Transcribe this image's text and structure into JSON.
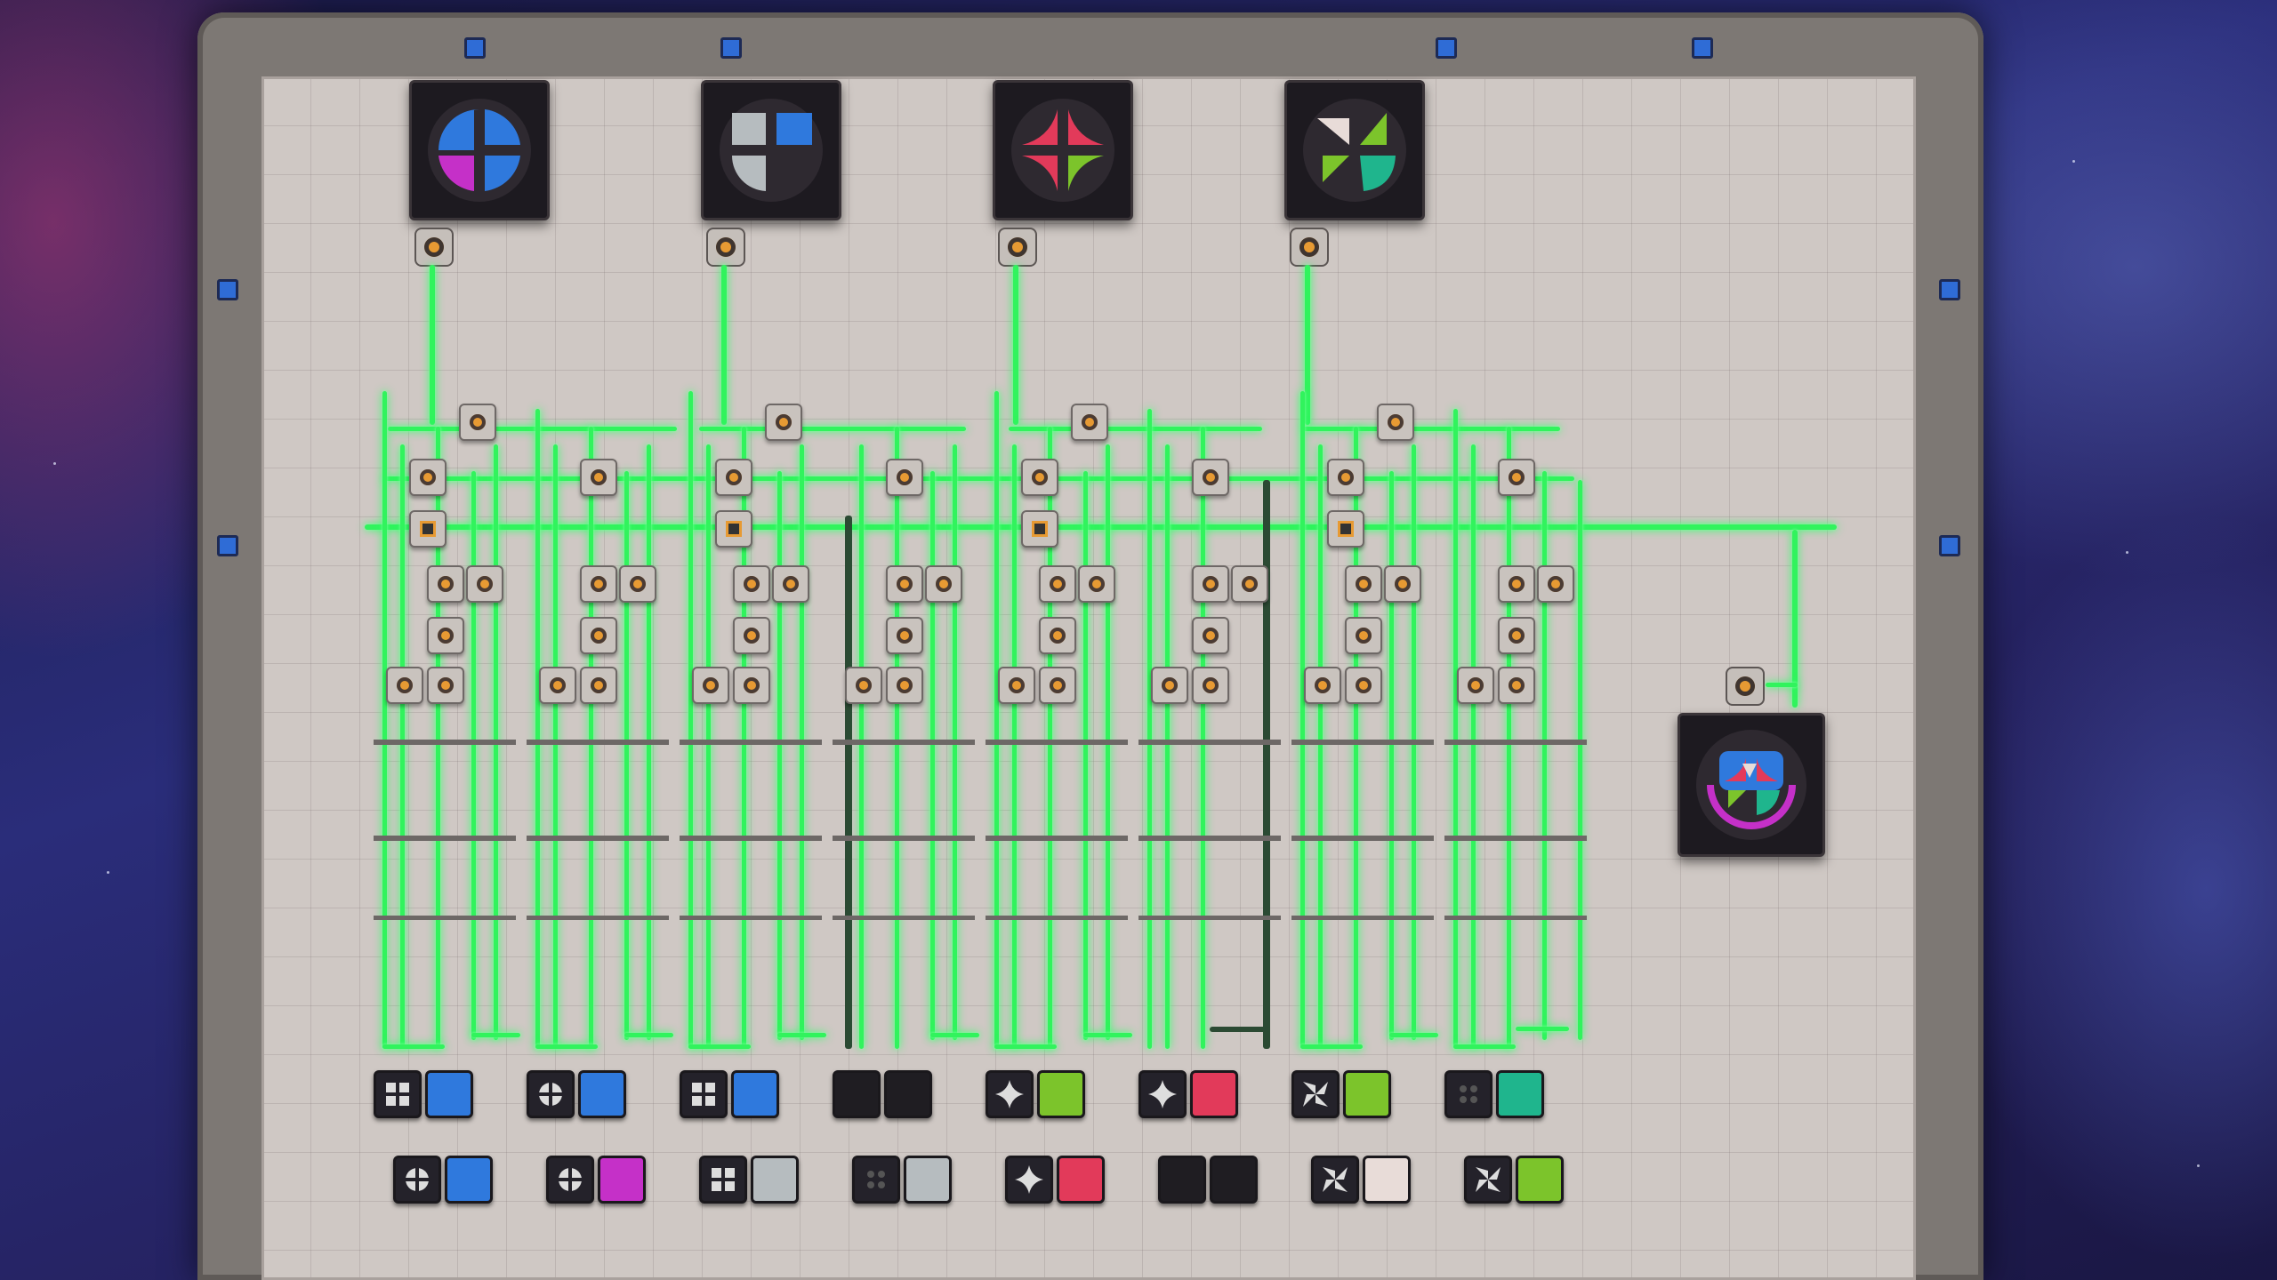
{
  "colors": {
    "belt": "#31f35d",
    "blue": "#2f79dd",
    "magenta": "#c530c8",
    "gray": "#b6bcbf",
    "green": "#7cc42b",
    "red": "#e23a5a",
    "teal": "#1fb58d",
    "pale": "#e8dcd8",
    "black": "#1f1d22"
  },
  "hubs": [
    {
      "name": "quad-blue-magenta-shape-icon"
    },
    {
      "name": "quad-gray-blue-shape-icon"
    },
    {
      "name": "star-red-green-shape-icon"
    },
    {
      "name": "windmill-green-teal-shape-icon"
    }
  ],
  "output_hub": {
    "name": "combined-multicolor-shape-icon"
  },
  "row1_tiles": [
    [
      "grid",
      "blue"
    ],
    [
      "circle-cross",
      "blue"
    ],
    [
      "grid",
      "blue"
    ],
    [
      "black",
      "black"
    ],
    [
      "star",
      "green"
    ],
    [
      "star",
      "red"
    ],
    [
      "windmill",
      "green"
    ],
    [
      "dots",
      "teal"
    ]
  ],
  "row2_tiles": [
    [
      "circle-cross",
      "blue"
    ],
    [
      "circle-cross",
      "magenta"
    ],
    [
      "grid",
      "gray"
    ],
    [
      "dots",
      "gray"
    ],
    [
      "star",
      "red"
    ],
    [
      "black",
      "black"
    ],
    [
      "windmill",
      "pale"
    ],
    [
      "windmill",
      "green"
    ]
  ]
}
